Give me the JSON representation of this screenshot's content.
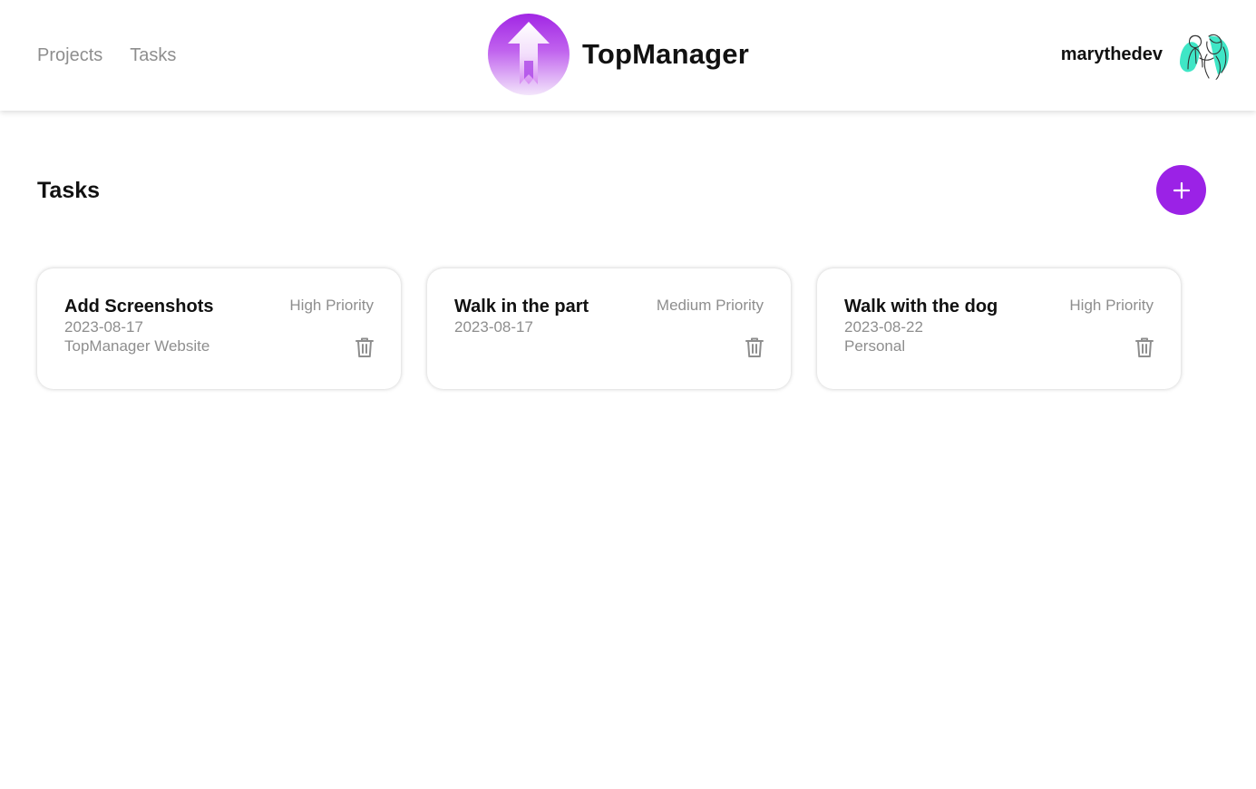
{
  "header": {
    "nav": [
      {
        "label": "Projects"
      },
      {
        "label": "Tasks"
      }
    ],
    "brand": {
      "name": "TopManager",
      "icon": "up-arrow-logo-icon"
    },
    "user": {
      "name": "marythedev",
      "avatar": "avatar-illustration"
    }
  },
  "page": {
    "title": "Tasks",
    "add_icon": "plus-icon"
  },
  "tasks": [
    {
      "title": "Add Screenshots",
      "date": "2023-08-17",
      "project": "TopManager Website",
      "priority": "High Priority",
      "delete_icon": "trash-icon"
    },
    {
      "title": "Walk in the part",
      "date": "2023-08-17",
      "project": "",
      "priority": "Medium Priority",
      "delete_icon": "trash-icon"
    },
    {
      "title": "Walk with the dog",
      "date": "2023-08-22",
      "project": "Personal",
      "priority": "High Priority",
      "delete_icon": "trash-icon"
    }
  ],
  "colors": {
    "accent": "#9b22e6",
    "muted_text": "#8e8e8e",
    "avatar_accent": "#3fe6c6"
  }
}
